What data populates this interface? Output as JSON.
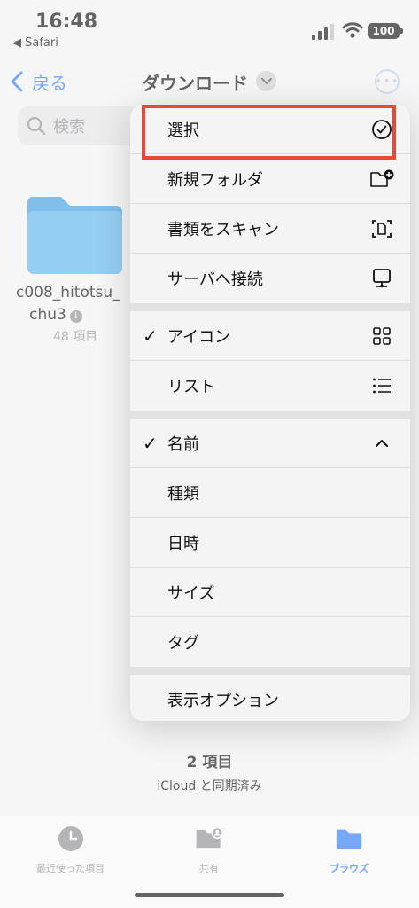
{
  "status_bar": {
    "time": "16:48",
    "back_app": "◀ Safari",
    "battery": "100"
  },
  "nav": {
    "back_label": "戻る",
    "title": "ダウンロード",
    "more_label": "•••"
  },
  "search": {
    "placeholder": "検索"
  },
  "folder": {
    "name_line1": "c008_hitotsu_",
    "name_line2": "chu3",
    "count": "48 項目",
    "color": "#5bb4ec"
  },
  "menu": {
    "actions": [
      {
        "label": "選択",
        "icon": "checkmark-circle-icon"
      },
      {
        "label": "新規フォルダ",
        "icon": "folder-plus-icon"
      },
      {
        "label": "書類をスキャン",
        "icon": "doc-scan-icon"
      },
      {
        "label": "サーバへ接続",
        "icon": "server-display-icon"
      }
    ],
    "view": [
      {
        "label": "アイコン",
        "checked": "✓",
        "icon": "grid-icon"
      },
      {
        "label": "リスト",
        "checked": "",
        "icon": "list-icon"
      }
    ],
    "sort": [
      {
        "label": "名前",
        "checked": "✓",
        "icon": "chevron-up-icon"
      },
      {
        "label": "種類",
        "checked": ""
      },
      {
        "label": "日時",
        "checked": ""
      },
      {
        "label": "サイズ",
        "checked": ""
      },
      {
        "label": "タグ",
        "checked": ""
      }
    ],
    "options": {
      "label": "表示オプション"
    }
  },
  "footer": {
    "item_count": "2 項目",
    "sync_status": "iCloud と同期済み"
  },
  "tabs": [
    {
      "label": "最近使った項目",
      "icon": "clock-icon"
    },
    {
      "label": "共有",
      "icon": "shared-folder-icon"
    },
    {
      "label": "ブラウズ",
      "icon": "folder-icon"
    }
  ],
  "colors": {
    "accent": "#2b7cf0",
    "highlight_border": "#e8473a"
  }
}
